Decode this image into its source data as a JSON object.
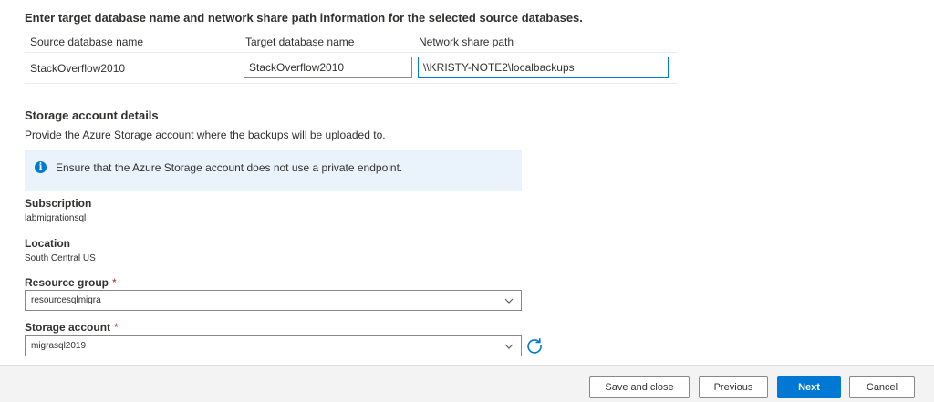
{
  "header": {
    "instruction": "Enter target database name and network share path information for the selected source databases."
  },
  "table": {
    "columns": [
      "Source database name",
      "Target database name",
      "Network share path"
    ],
    "rows": [
      {
        "source": "StackOverflow2010",
        "target": "StackOverflow2010",
        "share_path": "\\\\KRISTY-NOTE2\\localbackups"
      }
    ]
  },
  "storage": {
    "title": "Storage account details",
    "description": "Provide the Azure Storage account where the backups will be uploaded to.",
    "info": "Ensure that the Azure Storage account does not use a private endpoint.",
    "subscription_label": "Subscription",
    "subscription_value": "labmigrationsql",
    "location_label": "Location",
    "location_value": "South Central US",
    "resource_group_label": "Resource group",
    "resource_group_value": "resourcesqlmigra",
    "storage_account_label": "Storage account",
    "storage_account_value": "migrasql2019",
    "required_mark": "*"
  },
  "footer": {
    "save_close": "Save and close",
    "previous": "Previous",
    "next": "Next",
    "cancel": "Cancel"
  },
  "icons": {
    "info": "info-icon",
    "chevron": "chevron-down-icon",
    "refresh": "refresh-icon",
    "info_glyph": "i"
  },
  "colors": {
    "accent": "#0078d4",
    "info_background": "#eaf3fb",
    "required": "#a4262c"
  }
}
